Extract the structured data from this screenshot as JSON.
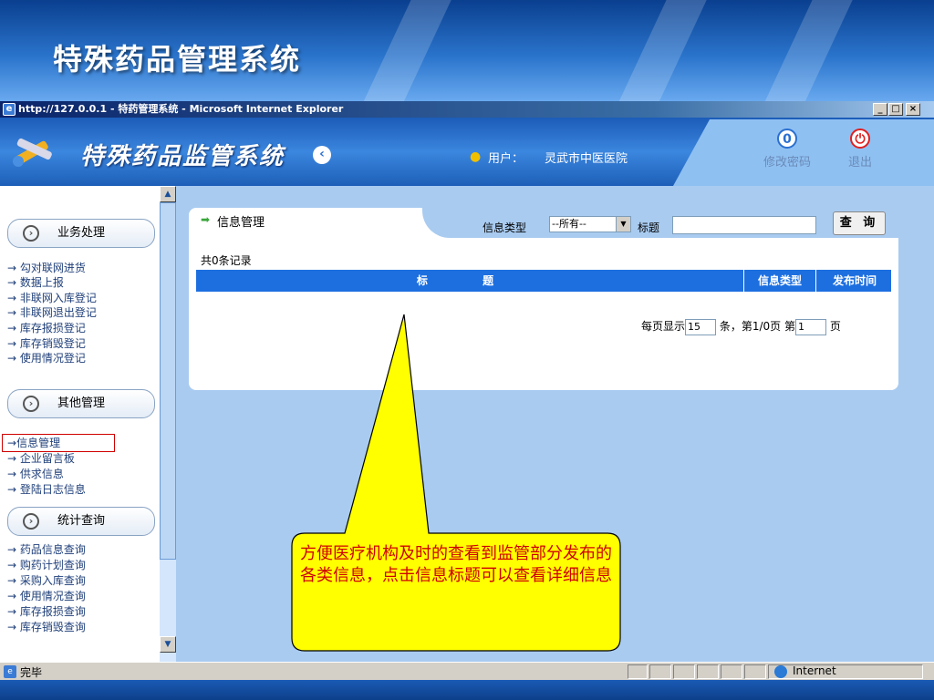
{
  "slide": {
    "title": "特殊药品管理系统"
  },
  "browser": {
    "title": "http://127.0.0.1 - 特药管理系统 - Microsoft Internet Explorer",
    "buttons": {
      "minimize": "_",
      "maximize": "□",
      "close": "×"
    },
    "status_text": "完毕",
    "zone_label": "Internet"
  },
  "app": {
    "title": "特殊药品监管系统",
    "user_label": "用户：",
    "user_name": "灵武市中医医院",
    "change_password": "修改密码",
    "logout": "退出"
  },
  "sidebar": {
    "sections": [
      {
        "label": "业务处理",
        "items": [
          "勾对联网进货",
          "数据上报",
          "非联网入库登记",
          "非联网退出登记",
          "库存报损登记",
          "库存销毁登记",
          "使用情况登记"
        ]
      },
      {
        "label": "其他管理",
        "items": [
          "信息管理",
          "企业留言板",
          "供求信息",
          "登陆日志信息"
        ]
      },
      {
        "label": "统计查询",
        "items": [
          "药品信息查询",
          "购药计划查询",
          "采购入库查询",
          "使用情况查询",
          "库存报损查询",
          "库存销毁查询"
        ]
      }
    ],
    "selected_item": "信息管理"
  },
  "content": {
    "tab_label": "信息管理",
    "filter_type_label": "信息类型",
    "filter_type_value": "--所有--",
    "filter_title_label": "标题",
    "filter_title_value": "",
    "query_button": "查 询",
    "record_count": "共0条记录",
    "table_columns": [
      "标 题",
      "信息类型",
      "发布时间"
    ],
    "pager": {
      "prefix": "每页显示",
      "page_size": "15",
      "middle": "条，第1/0页  第",
      "page_number": "1",
      "suffix": "页"
    }
  },
  "callout": {
    "text": "方便医疗机构及时的查看到监管部分发布的各类信息，点击信息标题可以查看详细信息",
    "fill": "#ffff00",
    "text_color": "#d00000"
  }
}
